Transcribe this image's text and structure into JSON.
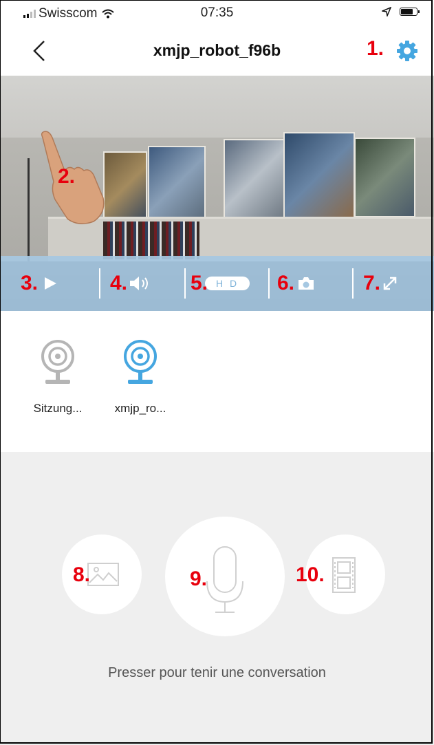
{
  "status_bar": {
    "carrier": "Swisscom",
    "time": "07:35"
  },
  "nav": {
    "title": "xmjp_robot_f96b",
    "back_icon": "chevron-left-icon",
    "settings_icon": "gear-icon"
  },
  "callouts": {
    "settings": "1.",
    "video": "2.",
    "play": "3.",
    "sound": "4.",
    "hd": "5.",
    "snapshot": "6.",
    "fullscreen": "7.",
    "gallery": "8.",
    "talk": "9.",
    "recordings": "10."
  },
  "controls": {
    "hd_label": "H D"
  },
  "devices": [
    {
      "name": "Sitzung...",
      "icon": "camera-icon",
      "selected": false
    },
    {
      "name": "xmjp_ro...",
      "icon": "camera-icon",
      "selected": true
    }
  ],
  "panel": {
    "hint": "Presser pour tenir une conversation"
  },
  "colors": {
    "accent": "#45a6e0",
    "callout": "#e8000d",
    "control_bar": "#a6c8e2",
    "panel_bg": "#efefef"
  }
}
